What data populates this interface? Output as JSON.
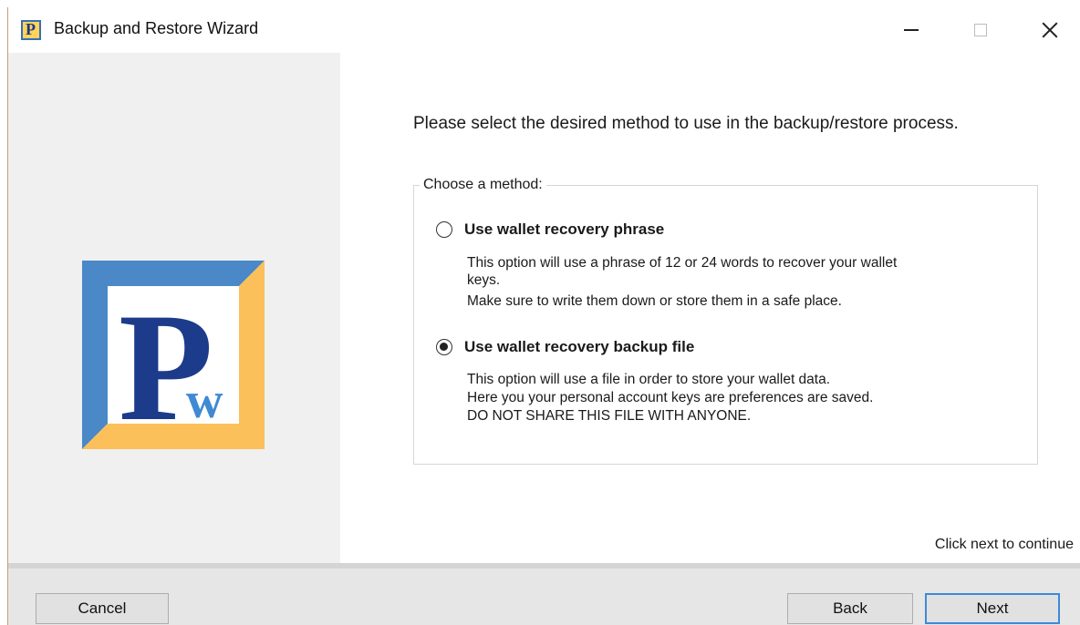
{
  "window": {
    "title": "Backup and Restore Wizard",
    "icon": "app-logo-icon",
    "controls": [
      "minimize-icon",
      "maximize-icon",
      "close-icon"
    ]
  },
  "logo": {
    "letter_main": "P",
    "letter_sub": "w",
    "colors": {
      "blue": "#4a88c8",
      "gold": "#fcc05a",
      "navy": "#1c3b8a",
      "light_blue": "#3f8ad2"
    }
  },
  "main": {
    "prompt": "Please select the desired method to use in the backup/restore process.",
    "group_label": "Choose a method:",
    "options": [
      {
        "label": "Use wallet recovery phrase",
        "selected": false,
        "description": [
          "This option will use a phrase of 12 or 24 words to recover your wallet",
          "keys.",
          "Make sure to write them down or store them in a safe place."
        ]
      },
      {
        "label": "Use wallet recovery backup file",
        "selected": true,
        "description": [
          "This option will use a file in order to store your wallet data.",
          "Here you your personal account keys are preferences are saved.",
          "DO NOT SHARE THIS FILE WITH ANYONE."
        ]
      }
    ],
    "continue_hint": "Click next to continue"
  },
  "footer": {
    "cancel_label": "Cancel",
    "back_label": "Back",
    "next_label": "Next"
  }
}
